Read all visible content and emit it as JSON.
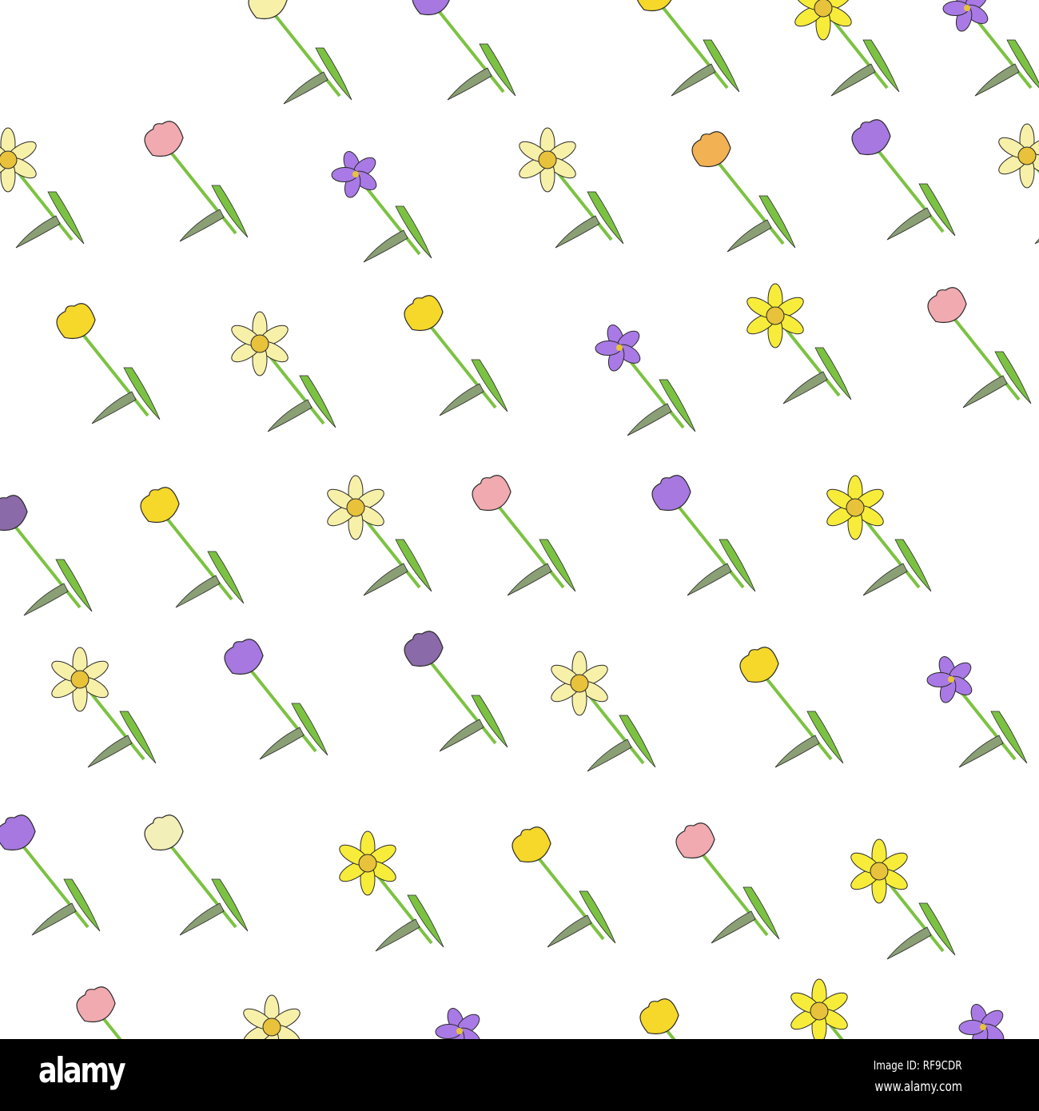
{
  "watermark": {
    "logo": "alamy",
    "image_id": "Image ID: RF9CDR",
    "website": "www.alamy.com"
  },
  "colors": {
    "stem": "#7cc242",
    "stem_dark": "#8a9f74",
    "outline": "#2b2b2b",
    "tulip_purple": "#a678e0",
    "tulip_dark_purple": "#8a6aa8",
    "tulip_yellow": "#f5d82a",
    "tulip_pink": "#f0aab0",
    "tulip_orange": "#f2b152",
    "tulip_cream": "#f3efb8",
    "daffodil_pale": "#f7f0a8",
    "daffodil_bright": "#f7ec3a",
    "daffodil_cup": "#e8c23a",
    "crocus": "#a97ae6"
  }
}
